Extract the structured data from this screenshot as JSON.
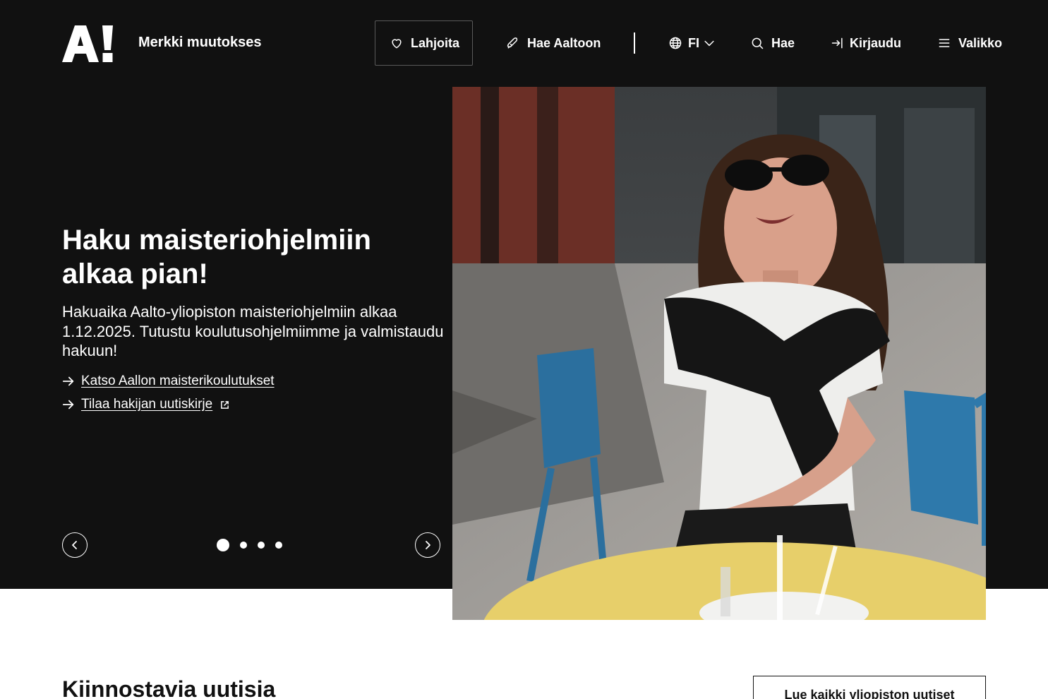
{
  "header": {
    "tagline": "Merkki muutokses",
    "nav": {
      "donate": "Lahjoita",
      "apply": "Hae Aaltoon",
      "language": "FI",
      "search": "Hae",
      "login": "Kirjaudu",
      "menu": "Valikko"
    },
    "icons": {
      "logo": "aalto-logo",
      "donate": "heart-icon",
      "apply": "rocket-icon",
      "language": "globe-icon",
      "language_toggle": "chevron-down-icon",
      "search": "search-icon",
      "login": "login-icon",
      "menu": "hamburger-icon"
    }
  },
  "hero": {
    "title": "Haku maisteriohjelmiin alkaa pian!",
    "text": "Hakuaika Aalto-yliopiston maisteriohjelmiin alkaa 1.12.2025. Tutustu koulutusohjelmiimme ja valmistaudu hakuun!",
    "links": [
      {
        "label": "Katso Aallon maisterikoulutukset",
        "external": false
      },
      {
        "label": "Tilaa hakijan uutiskirje",
        "external": true
      }
    ],
    "carousel": {
      "slides": 4,
      "active": 1
    }
  },
  "news": {
    "heading": "Kiinnostavia uutisia",
    "all_button": "Lue kaikki yliopiston uutiset"
  },
  "colors": {
    "hero_background": "#111111",
    "text_on_dark": "#ffffff",
    "page_background": "#ffffff"
  }
}
